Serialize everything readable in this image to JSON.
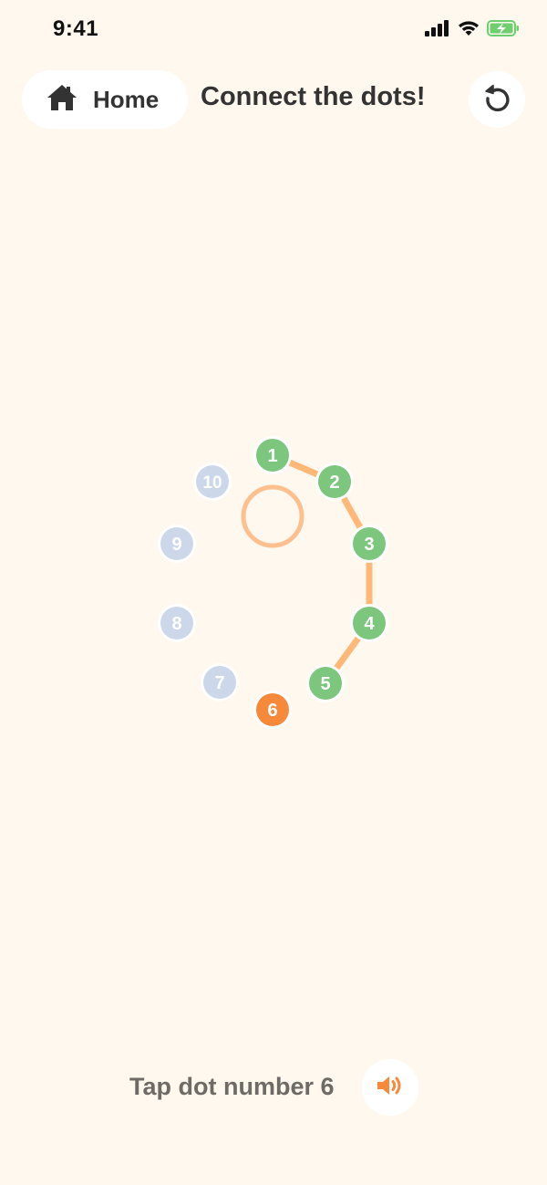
{
  "status_bar": {
    "time": "9:41",
    "icons": [
      "cellular-signal-icon",
      "wifi-icon",
      "battery-charging-icon"
    ]
  },
  "header": {
    "home_label": "Home",
    "home_icon": "house-icon",
    "title": "Connect the dots!",
    "reset_icon": "restart-icon"
  },
  "game": {
    "dots": [
      {
        "number": "1",
        "state": "done"
      },
      {
        "number": "2",
        "state": "done"
      },
      {
        "number": "3",
        "state": "done"
      },
      {
        "number": "4",
        "state": "done"
      },
      {
        "number": "5",
        "state": "done"
      },
      {
        "number": "6",
        "state": "current"
      },
      {
        "number": "7",
        "state": "pending"
      },
      {
        "number": "8",
        "state": "pending"
      },
      {
        "number": "9",
        "state": "pending"
      },
      {
        "number": "10",
        "state": "pending"
      }
    ],
    "connected_up_to": 5,
    "colors": {
      "done": "#7CC67E",
      "current": "#F7893B",
      "pending": "#CCD8EA",
      "line": "#FFB878",
      "ring": "#FFC090"
    }
  },
  "footer": {
    "prompt": "Tap dot number 6",
    "sound_icon": "speaker-icon",
    "sound_color": "#F7893B"
  }
}
